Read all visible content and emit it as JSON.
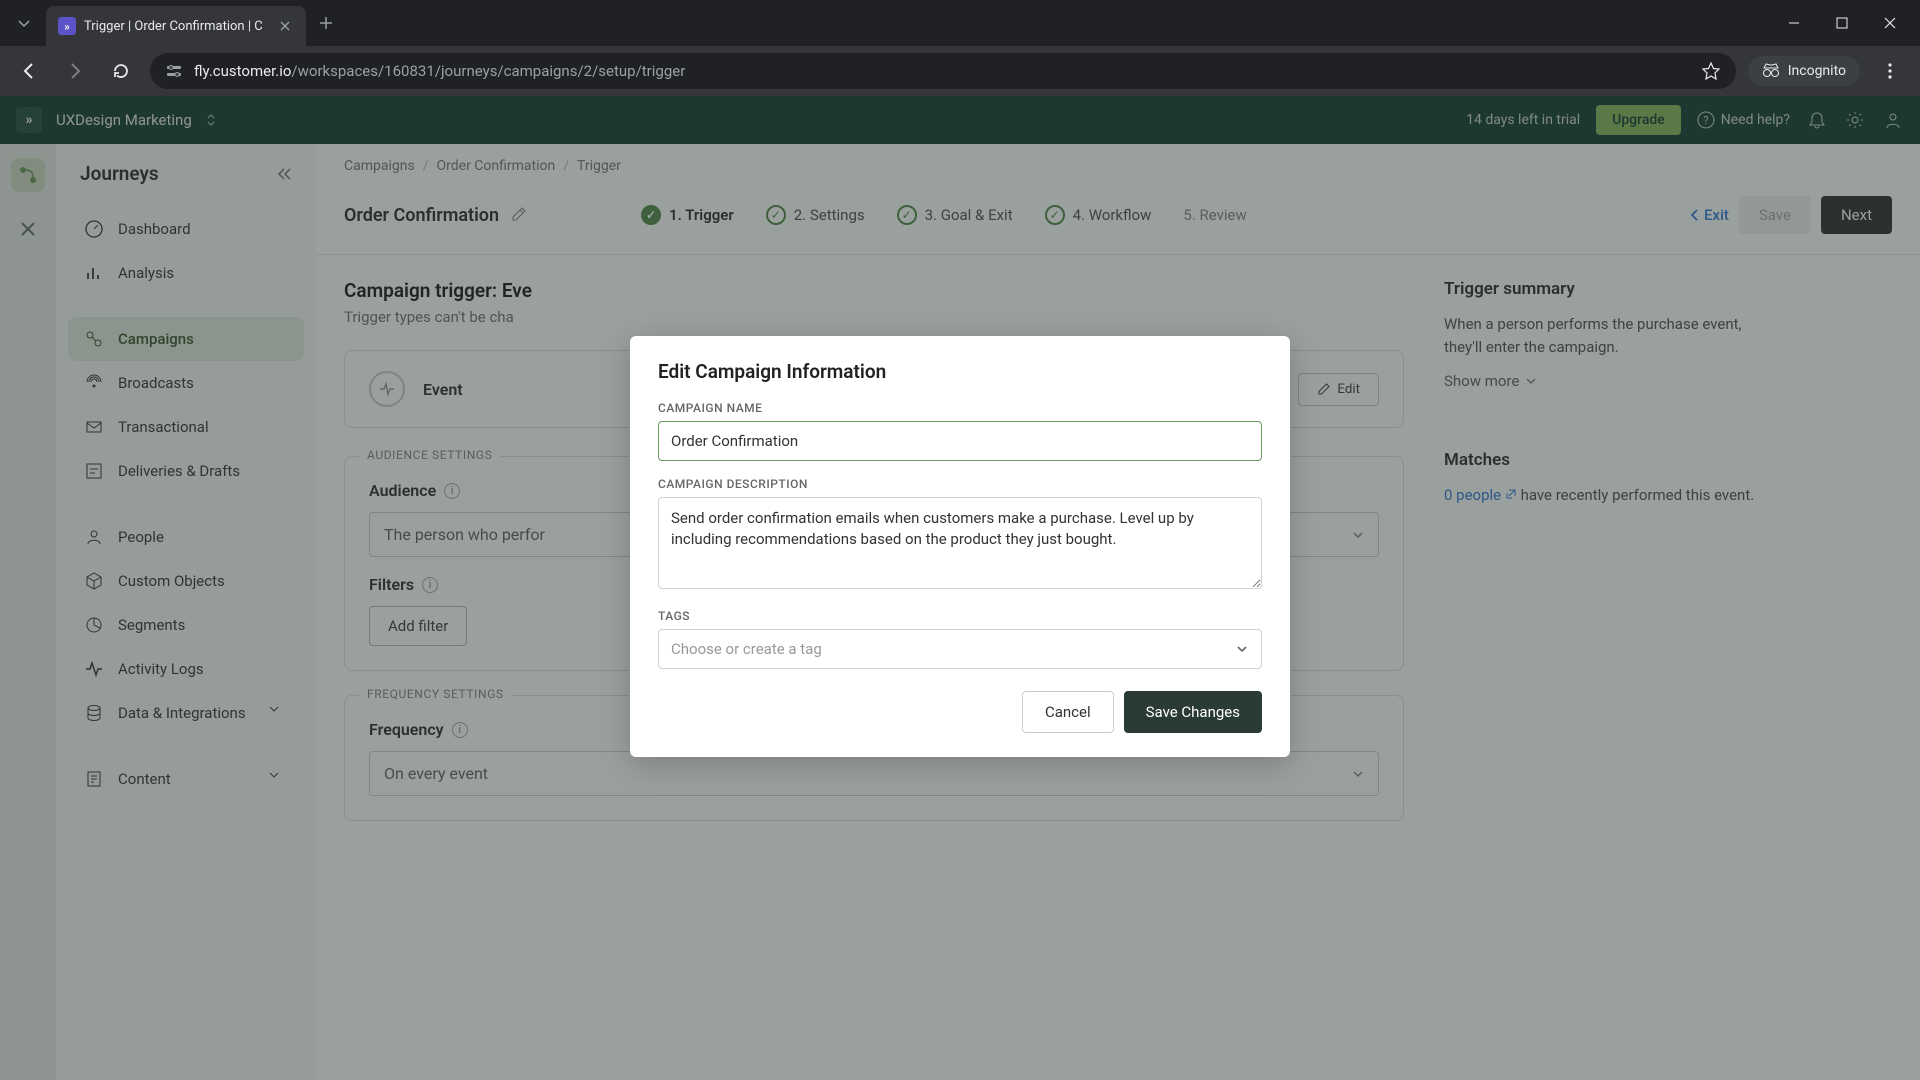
{
  "browser": {
    "tab_title": "Trigger | Order Confirmation | C",
    "url_prefix": "fly.customer.io",
    "url_path": "/workspaces/160831/journeys/campaigns/2/setup/trigger",
    "incognito": "Incognito"
  },
  "topbar": {
    "workspace": "UXDesign Marketing",
    "trial": "14 days left in trial",
    "upgrade": "Upgrade",
    "help": "Need help?"
  },
  "sidebar": {
    "title": "Journeys",
    "items": {
      "dashboard": "Dashboard",
      "analysis": "Analysis",
      "campaigns": "Campaigns",
      "broadcasts": "Broadcasts",
      "transactional": "Transactional",
      "deliveries": "Deliveries & Drafts",
      "people": "People",
      "custom_objects": "Custom Objects",
      "segments": "Segments",
      "activity": "Activity Logs",
      "data": "Data & Integrations",
      "content": "Content"
    }
  },
  "breadcrumb": {
    "a": "Campaigns",
    "b": "Order Confirmation",
    "c": "Trigger"
  },
  "header": {
    "campaign": "Order Confirmation",
    "steps": {
      "s1": "1. Trigger",
      "s2": "2. Settings",
      "s3": "3. Goal & Exit",
      "s4": "4. Workflow",
      "s5": "5. Review"
    },
    "exit": "Exit",
    "save": "Save",
    "next": "Next"
  },
  "page": {
    "trigger_title": "Campaign trigger: Eve",
    "trigger_sub": "Trigger types can't be cha",
    "event_label": "Event",
    "edit": "Edit",
    "audience_legend": "AUDIENCE SETTINGS",
    "audience": "Audience",
    "audience_select": "The person who perfor",
    "filters": "Filters",
    "add_filter": "Add filter",
    "frequency_legend": "FREQUENCY SETTINGS",
    "frequency": "Frequency",
    "frequency_select": "On every event"
  },
  "side": {
    "summary_title": "Trigger summary",
    "summary_text": "When a person performs the purchase event, they'll enter the campaign.",
    "show_more": "Show more",
    "matches_title": "Matches",
    "matches_link": "0 people",
    "matches_rest": " have recently performed this event."
  },
  "modal": {
    "title": "Edit Campaign Information",
    "name_label": "CAMPAIGN NAME",
    "name_value": "Order Confirmation",
    "desc_label": "CAMPAIGN DESCRIPTION",
    "desc_value": "Send order confirmation emails when customers make a purchase. Level up by including recommendations based on the product they just bought.",
    "tags_label": "TAGS",
    "tags_placeholder": "Choose or create a tag",
    "cancel": "Cancel",
    "save": "Save Changes"
  }
}
